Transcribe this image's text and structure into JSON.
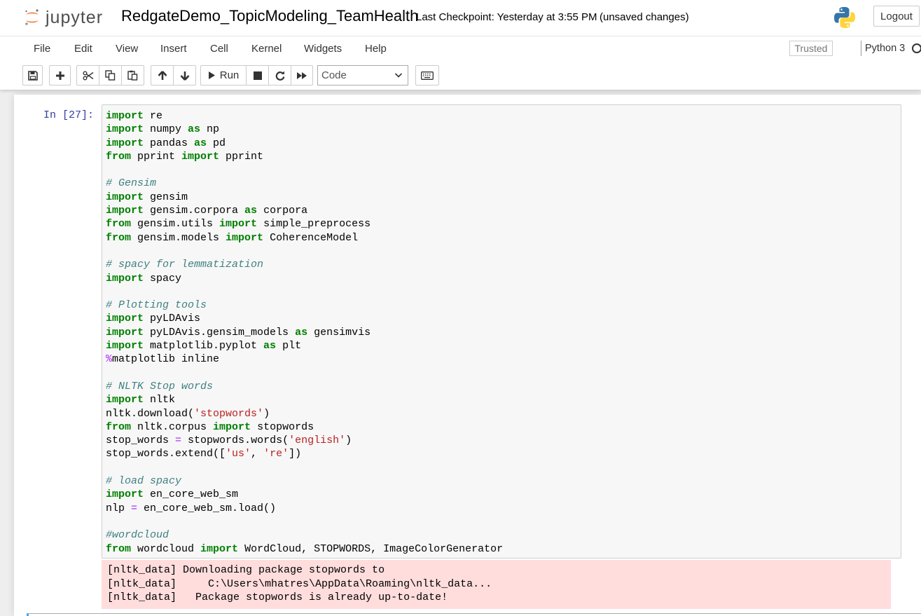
{
  "header": {
    "logo_text": "jupyter",
    "notebook_name": "RedgateDemo_TopicModeling_TeamHealth",
    "checkpoint": "Last Checkpoint: Yesterday at 3:55 PM",
    "autosave_status": "(unsaved changes)",
    "logout_label": "Logout"
  },
  "menubar": {
    "items": [
      "File",
      "Edit",
      "View",
      "Insert",
      "Cell",
      "Kernel",
      "Widgets",
      "Help"
    ],
    "trusted_label": "Trusted",
    "kernel_name": "Python 3",
    "kernel_status": "idle"
  },
  "toolbar": {
    "run_label": "Run",
    "cell_type": "Code",
    "buttons": [
      "save",
      "insert-cell-below",
      "cut",
      "copy",
      "paste",
      "move-up",
      "move-down",
      "run",
      "interrupt",
      "restart",
      "restart-run-all",
      "celltype",
      "command-palette"
    ]
  },
  "cell": {
    "prompt": "In [27]:",
    "code_lines": [
      [
        [
          "kw",
          "import"
        ],
        [
          "t",
          " re"
        ]
      ],
      [
        [
          "kw",
          "import"
        ],
        [
          "t",
          " numpy "
        ],
        [
          "kw",
          "as"
        ],
        [
          "t",
          " np"
        ]
      ],
      [
        [
          "kw",
          "import"
        ],
        [
          "t",
          " pandas "
        ],
        [
          "kw",
          "as"
        ],
        [
          "t",
          " pd"
        ]
      ],
      [
        [
          "kw",
          "from"
        ],
        [
          "t",
          " pprint "
        ],
        [
          "kw",
          "import"
        ],
        [
          "t",
          " pprint"
        ]
      ],
      [],
      [
        [
          "cm",
          "# Gensim"
        ]
      ],
      [
        [
          "kw",
          "import"
        ],
        [
          "t",
          " gensim"
        ]
      ],
      [
        [
          "kw",
          "import"
        ],
        [
          "t",
          " gensim.corpora "
        ],
        [
          "kw",
          "as"
        ],
        [
          "t",
          " corpora"
        ]
      ],
      [
        [
          "kw",
          "from"
        ],
        [
          "t",
          " gensim.utils "
        ],
        [
          "kw",
          "import"
        ],
        [
          "t",
          " simple_preprocess"
        ]
      ],
      [
        [
          "kw",
          "from"
        ],
        [
          "t",
          " gensim.models "
        ],
        [
          "kw",
          "import"
        ],
        [
          "t",
          " CoherenceModel"
        ]
      ],
      [],
      [
        [
          "cm",
          "# spacy for lemmatization"
        ]
      ],
      [
        [
          "kw",
          "import"
        ],
        [
          "t",
          " spacy"
        ]
      ],
      [],
      [
        [
          "cm",
          "# Plotting tools"
        ]
      ],
      [
        [
          "kw",
          "import"
        ],
        [
          "t",
          " pyLDAvis"
        ]
      ],
      [
        [
          "kw",
          "import"
        ],
        [
          "t",
          " pyLDAvis.gensim_models "
        ],
        [
          "kw",
          "as"
        ],
        [
          "t",
          " gensimvis"
        ]
      ],
      [
        [
          "kw",
          "import"
        ],
        [
          "t",
          " matplotlib.pyplot "
        ],
        [
          "kw",
          "as"
        ],
        [
          "t",
          " plt"
        ]
      ],
      [
        [
          "mg",
          "%"
        ],
        [
          "t",
          "matplotlib inline"
        ]
      ],
      [],
      [
        [
          "cm",
          "# NLTK Stop words"
        ]
      ],
      [
        [
          "kw",
          "import"
        ],
        [
          "t",
          " nltk"
        ]
      ],
      [
        [
          "t",
          "nltk.download("
        ],
        [
          "st",
          "'stopwords'"
        ],
        [
          "t",
          ")"
        ]
      ],
      [
        [
          "kw",
          "from"
        ],
        [
          "t",
          " nltk.corpus "
        ],
        [
          "kw",
          "import"
        ],
        [
          "t",
          " stopwords"
        ]
      ],
      [
        [
          "t",
          "stop_words "
        ],
        [
          "op",
          "="
        ],
        [
          "t",
          " stopwords.words("
        ],
        [
          "st",
          "'english'"
        ],
        [
          "t",
          ")"
        ]
      ],
      [
        [
          "t",
          "stop_words.extend(["
        ],
        [
          "st",
          "'us'"
        ],
        [
          "t",
          ", "
        ],
        [
          "st",
          "'re'"
        ],
        [
          "t",
          "])"
        ]
      ],
      [],
      [
        [
          "cm",
          "# load spacy"
        ]
      ],
      [
        [
          "kw",
          "import"
        ],
        [
          "t",
          " en_core_web_sm"
        ]
      ],
      [
        [
          "t",
          "nlp "
        ],
        [
          "op",
          "="
        ],
        [
          "t",
          " en_core_web_sm.load()"
        ]
      ],
      [],
      [
        [
          "cm",
          "#wordcloud"
        ]
      ],
      [
        [
          "kw",
          "from"
        ],
        [
          "t",
          " wordcloud "
        ],
        [
          "kw",
          "import"
        ],
        [
          "t",
          " WordCloud, STOPWORDS, ImageColorGenerator"
        ]
      ]
    ],
    "stderr_lines": [
      "[nltk_data] Downloading package stopwords to",
      "[nltk_data]     C:\\Users\\mhatres\\AppData\\Roaming\\nltk_data...",
      "[nltk_data]   Package stopwords is already up-to-date!"
    ]
  },
  "colors": {
    "keyword": "#008000",
    "comment": "#408080",
    "string": "#ba2121",
    "operator": "#aa22ff",
    "prompt": "#303f9f",
    "stderr_bg": "#ffdddd"
  }
}
